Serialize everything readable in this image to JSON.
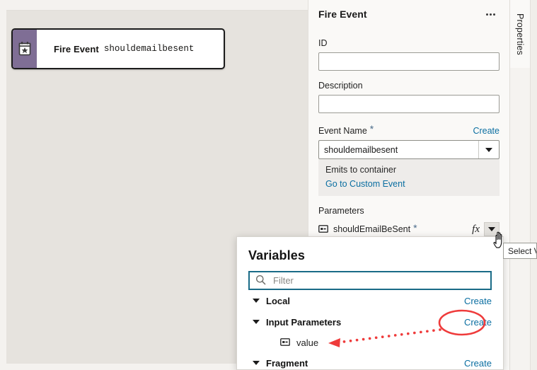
{
  "canvas": {
    "node": {
      "icon": "calendar-star-icon",
      "title": "Fire Event",
      "value": "shouldemailbesent"
    }
  },
  "properties_panel": {
    "header": {
      "title": "Fire Event",
      "more_icon": "ellipsis-icon"
    },
    "fields": {
      "id_label": "ID",
      "id_value": "",
      "id_placeholder": "",
      "description_label": "Description",
      "description_value": "",
      "description_placeholder": "",
      "event_name_label": "Event Name",
      "event_name_required": "*",
      "event_name_create": "Create",
      "event_name_value": "shouldemailbesent",
      "emits_text": "Emits to container",
      "custom_event_link": "Go to Custom Event"
    },
    "parameters": {
      "title": "Parameters",
      "rows": [
        {
          "icon": "variable-icon",
          "name": "shouldEmailBeSent",
          "required": "*",
          "fx_label": "fx",
          "caret_icon": "chevron-down-icon"
        }
      ]
    }
  },
  "vertical_tab": {
    "label": "Properties"
  },
  "variables_popup": {
    "title": "Variables",
    "filter": {
      "icon": "search-icon",
      "value": "",
      "placeholder": "Filter"
    },
    "groups": [
      {
        "label": "Local",
        "create": "Create",
        "items": []
      },
      {
        "label": "Input Parameters",
        "create": "Create",
        "items": [
          {
            "icon": "variable-icon",
            "label": "value"
          }
        ]
      },
      {
        "label": "Fragment",
        "create": "Create",
        "items": []
      }
    ]
  },
  "tooltip": {
    "text": "Select V"
  },
  "annotations": {
    "highlight_color": "#ef3b3b",
    "circle_target": "Input Parameters Create link",
    "arrow_target": "value variable item"
  },
  "colors": {
    "canvas_bg": "#e6e3de",
    "panel_bg": "#faf9f7",
    "node_accent": "#7f6e95",
    "link": "#0a6ea1",
    "focus_border": "#1a6b87",
    "annotation_red": "#ef3b3b"
  }
}
